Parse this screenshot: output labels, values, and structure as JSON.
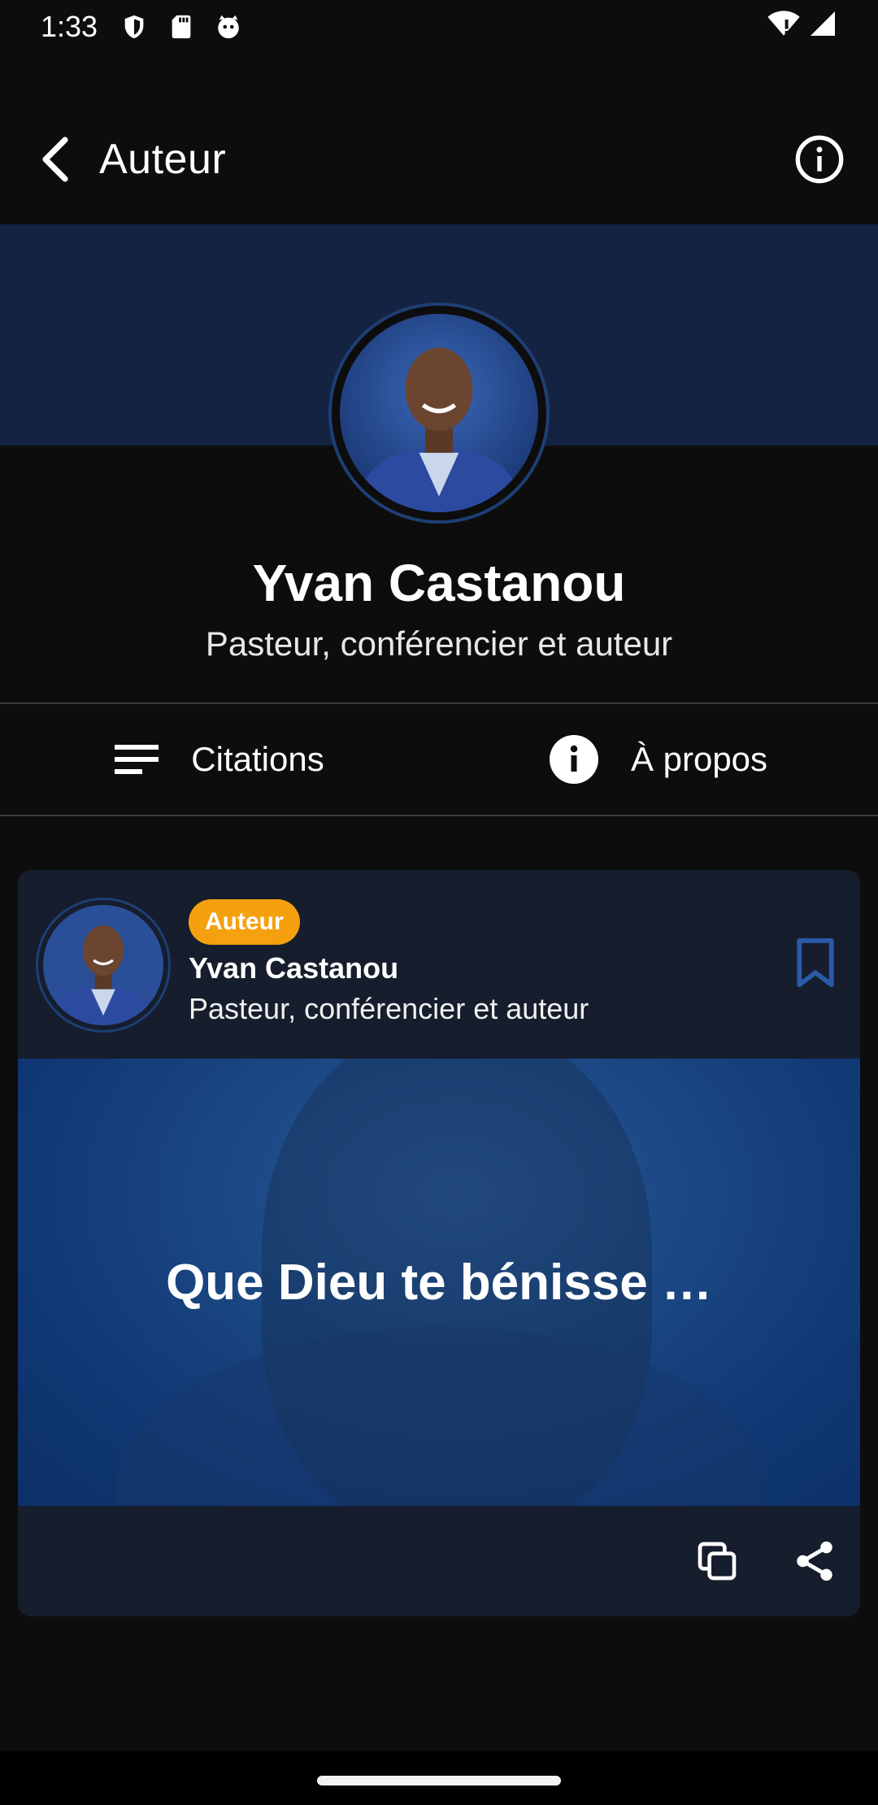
{
  "status_bar": {
    "time": "1:33",
    "icons": [
      "shield-icon",
      "sd-card-icon",
      "cat-face-icon"
    ],
    "right_icons": [
      "wifi-alert-icon",
      "signal-icon"
    ]
  },
  "app_bar": {
    "title": "Auteur",
    "back_icon": "arrow-back-icon",
    "info_icon": "info-outline-icon"
  },
  "profile": {
    "name": "Yvan Castanou",
    "role": "Pasteur, conférencier et auteur"
  },
  "tabs": [
    {
      "label": "Citations",
      "icon": "list-icon"
    },
    {
      "label": "À propos",
      "icon": "info-filled-icon"
    }
  ],
  "card": {
    "badge": "Auteur",
    "name": "Yvan Castanou",
    "role": "Pasteur, conférencier et auteur",
    "quote": "Que Dieu te bénisse …",
    "bookmark_icon": "bookmark-outline-icon",
    "actions": [
      "copy-icon",
      "share-icon"
    ]
  },
  "colors": {
    "background": "#0d0d0d",
    "header_band": "#152342",
    "card": "#161d2d",
    "quote_bg": "#1c4985",
    "badge": "#f5a10f",
    "accent_ring": "#1d3f75"
  }
}
